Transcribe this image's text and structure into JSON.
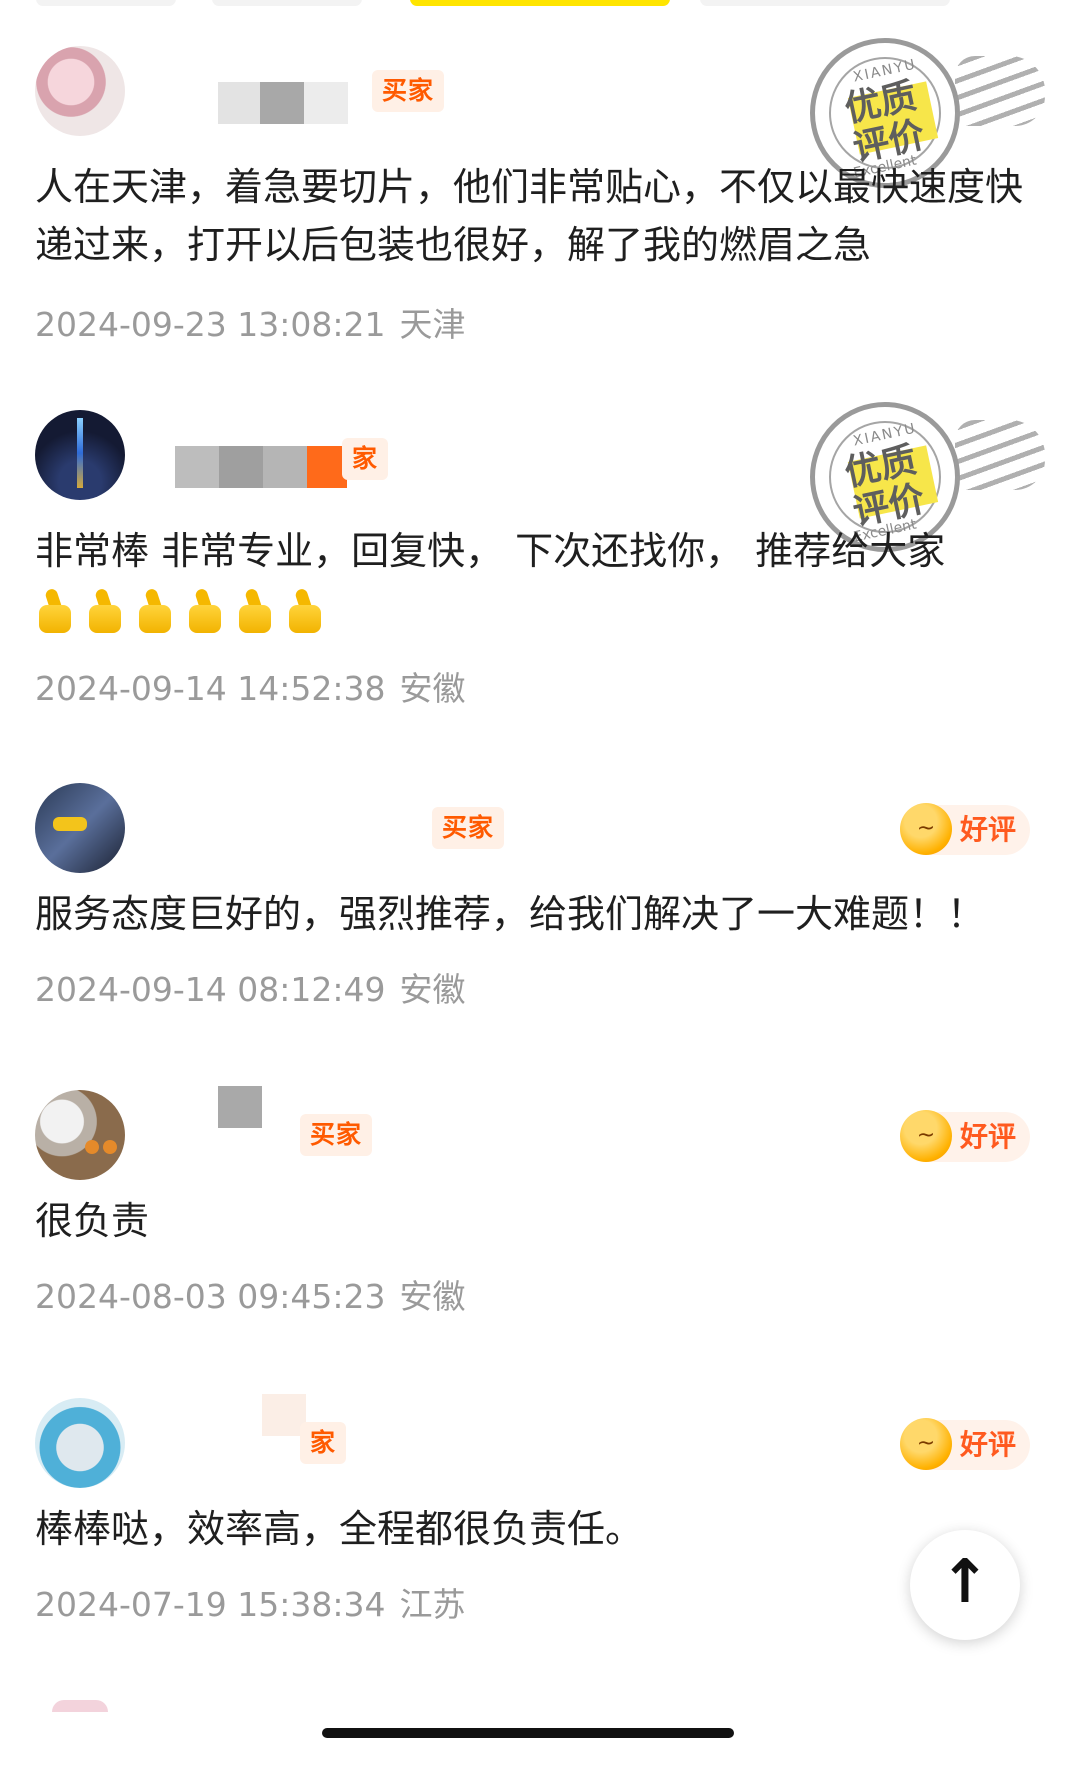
{
  "colors": {
    "accent_yellow": "#ffe500",
    "buyer_tag_text": "#ff5a00",
    "good_badge_text": "#ff5a1f",
    "meta_text": "#9a9a9a"
  },
  "stamp": {
    "top": "XIANYU",
    "main_line1": "优质",
    "main_line2": "评价",
    "bottom": "Excellent"
  },
  "reviews": [
    {
      "buyer_tag": "买家",
      "comment": "人在天津，着急要切片，他们非常贴心，不仅以最快速度快递过来，打开以后包装也很好，解了我的燃眉之急",
      "date": "2024-09-23 13:08:21",
      "location": "天津"
    },
    {
      "buyer_tag": "家",
      "comment": "非常棒 非常专业，回复快， 下次还找你， 推荐给大家",
      "thumbs_count": 6,
      "date": "2024-09-14 14:52:38",
      "location": "安徽"
    },
    {
      "buyer_tag": "买家",
      "badge": "好评",
      "comment": "服务态度巨好的，强烈推荐，给我们解决了一大难题！！",
      "date": "2024-09-14 08:12:49",
      "location": "安徽"
    },
    {
      "buyer_tag": "买家",
      "badge": "好评",
      "comment": "很负责",
      "date": "2024-08-03 09:45:23",
      "location": "安徽"
    },
    {
      "buyer_tag": "家",
      "badge": "好评",
      "comment": "棒棒哒，效率高，全程都很负责任。",
      "date": "2024-07-19 15:38:34",
      "location": "江苏"
    }
  ],
  "back_to_top_icon": "arrow-up-icon"
}
